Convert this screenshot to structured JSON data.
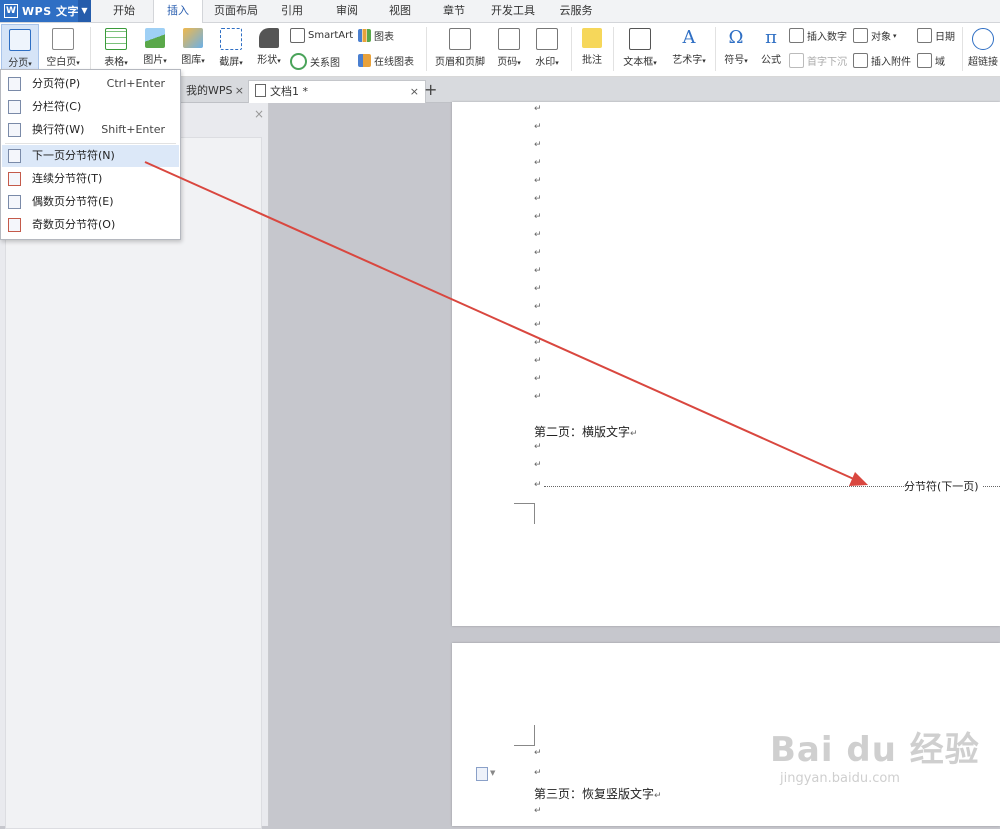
{
  "app": {
    "title": "WPS 文字"
  },
  "menu_tabs": [
    "开始",
    "插入",
    "页面布局",
    "引用",
    "审阅",
    "视图",
    "章节",
    "开发工具",
    "云服务"
  ],
  "active_menu_tab": "插入",
  "ribbon": {
    "fenye": "分页",
    "kongbaiye": "空白页",
    "biaoge": "表格",
    "tupian": "图片",
    "tuku": "图库",
    "jieping": "截屏",
    "xingzhuang": "形状",
    "smartart": "SmartArt",
    "guanxitu": "关系图",
    "tubiao": "图表",
    "zaixiantubiao": "在线图表",
    "yemeiheyejiao": "页眉和页脚",
    "yema": "页码",
    "shuiyin": "水印",
    "pizhu": "批注",
    "wenbenkuang": "文本框",
    "yishuzi": "艺术字",
    "fuhao": "符号",
    "gongshi": "公式",
    "charushuzi": "插入数字",
    "duixiang": "对象",
    "riqi": "日期",
    "shouzixiachen": "首字下沉",
    "charufujian": "插入附件",
    "yu": "域",
    "chaolianjie": "超链接"
  },
  "doc_tabs": [
    {
      "label": "我的WPS",
      "close": "×"
    },
    {
      "label": "文档1 *",
      "close": "×"
    }
  ],
  "new_tab": "+",
  "pane_close": "×",
  "dropdown": [
    {
      "label": "分页符(P)",
      "shortcut": "Ctrl+Enter"
    },
    {
      "label": "分栏符(C)",
      "shortcut": ""
    },
    {
      "label": "换行符(W)",
      "shortcut": "Shift+Enter"
    },
    {
      "label": "下一页分节符(N)",
      "shortcut": ""
    },
    {
      "label": "连续分节符(T)",
      "shortcut": ""
    },
    {
      "label": "偶数页分节符(E)",
      "shortcut": ""
    },
    {
      "label": "奇数页分节符(O)",
      "shortcut": ""
    }
  ],
  "highlighted_item": "下一页分节符(N)",
  "document": {
    "para_mark": "↵",
    "page2_text": "第二页：横版文字",
    "section_break_label": "分节符(下一页)",
    "page3_text": "第三页：恢复竖版文字"
  },
  "watermark": {
    "brand": "Bai du 经验",
    "url": "jingyan.baidu.com"
  },
  "colors": {
    "brand_blue": "#2f6fc4",
    "arrow_red": "#d9473f",
    "highlight": "#dce8f8"
  }
}
